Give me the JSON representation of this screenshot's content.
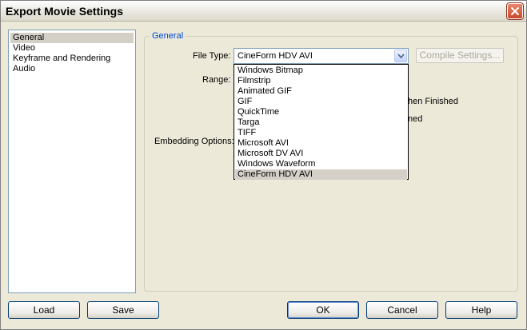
{
  "window": {
    "title": "Export Movie Settings"
  },
  "categories": {
    "items": [
      {
        "label": "General",
        "selected": true
      },
      {
        "label": "Video",
        "selected": false
      },
      {
        "label": "Keyframe and Rendering",
        "selected": false
      },
      {
        "label": "Audio",
        "selected": false
      }
    ]
  },
  "general": {
    "group_label": "General",
    "file_type_label": "File Type:",
    "file_type_value": "CineForm HDV AVI",
    "compile_settings_label": "Compile Settings...",
    "range_label": "Range:",
    "embedding_label": "Embedding Options:",
    "partial_when_finished": "hen Finished",
    "partial_ned": "ned"
  },
  "dropdown": {
    "options": [
      "Windows Bitmap",
      "Filmstrip",
      "Animated GIF",
      "GIF",
      "QuickTime",
      "Targa",
      "TIFF",
      "Microsoft AVI",
      "Microsoft DV AVI",
      "Windows Waveform",
      "CineForm HDV AVI"
    ],
    "selected_index": 10
  },
  "buttons": {
    "load": "Load",
    "save": "Save",
    "ok": "OK",
    "cancel": "Cancel",
    "help": "Help"
  }
}
